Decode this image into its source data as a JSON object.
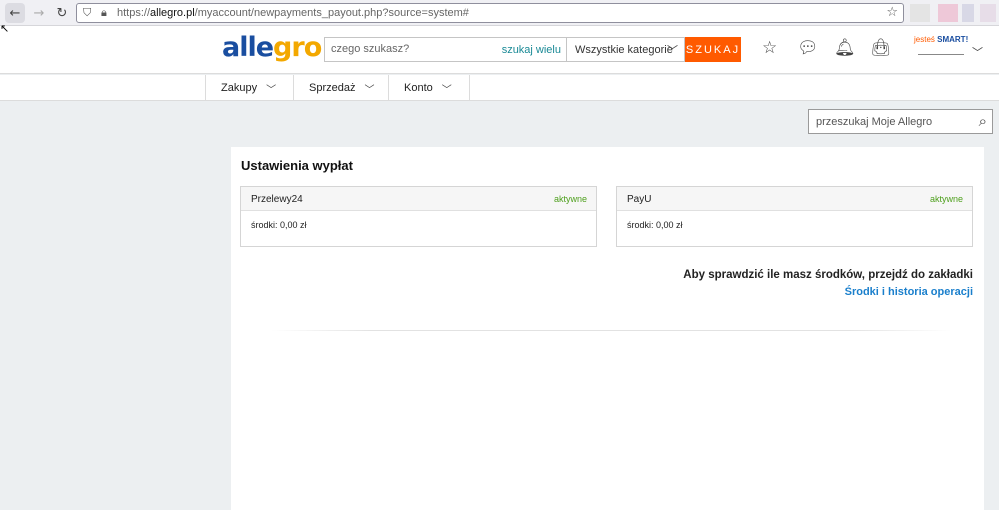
{
  "browser": {
    "back_icon": "arrow-left-icon",
    "forward_icon": "arrow-right-icon",
    "reload_icon": "reload-icon",
    "url_prefix": "https://",
    "url_domain": "allegro.pl",
    "url_path": "/myaccount/newpayments_payout.php?source=system#"
  },
  "header": {
    "logo_part1": "alle",
    "logo_part2": "gro",
    "search_placeholder": "czego szukasz?",
    "search_many": "szukaj wielu",
    "category": "Wszystkie kategorie",
    "search_button": "SZUKAJ",
    "smart_prefix": "jesteś ",
    "smart_word": "SMART!"
  },
  "subnav": {
    "items": [
      {
        "label": "Zakupy"
      },
      {
        "label": "Sprzedaż"
      },
      {
        "label": "Konto"
      }
    ]
  },
  "my_search": {
    "placeholder": "przeszukaj Moje Allegro"
  },
  "main": {
    "title": "Ustawienia wypłat",
    "providers": [
      {
        "name": "Przelewy24",
        "status": "aktywne",
        "funds": "środki: 0,00 zł"
      },
      {
        "name": "PayU",
        "status": "aktywne",
        "funds": "środki: 0,00 zł"
      }
    ],
    "info_text": "Aby sprawdzić ile masz środków, przejdź do zakładki",
    "info_link": "Środki i historia operacji"
  },
  "colors": {
    "accent": "#ff5a00",
    "brand_blue": "#1a4ea0",
    "brand_yellow": "#f3a800",
    "status_green": "#4fa01e",
    "link_blue": "#1a7fcc"
  }
}
